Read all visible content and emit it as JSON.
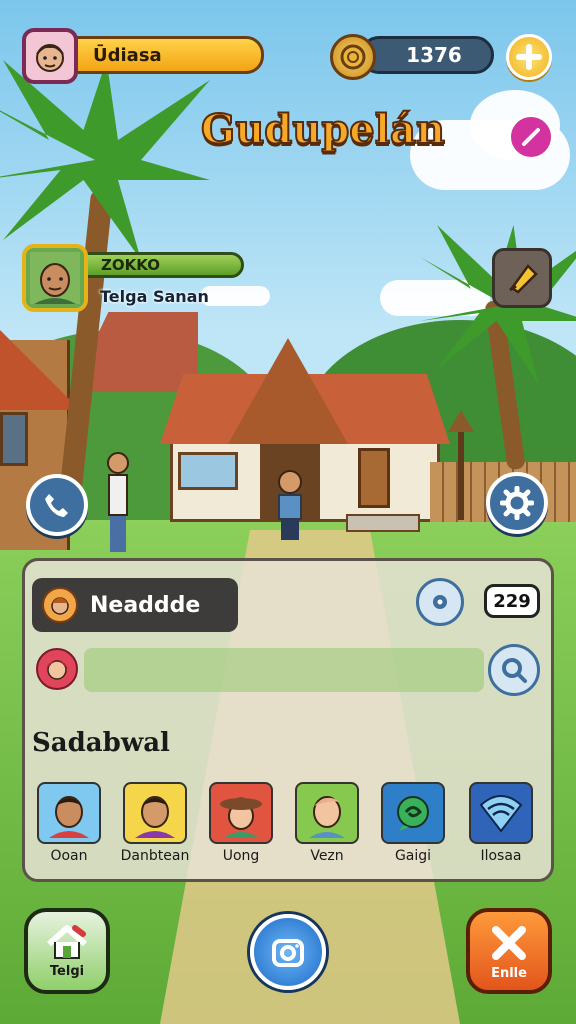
{
  "hud": {
    "player_name": "Ūdiasa",
    "coins": "1376"
  },
  "title": "Gudupelán",
  "npc": {
    "name": "ZOKKO",
    "location": "Telga Sanan"
  },
  "panel": {
    "chat_name": "Neaddde",
    "count": "229",
    "section_title": "Sadabwal",
    "characters": [
      {
        "name": "Ooan",
        "bg": "#7fc9f0"
      },
      {
        "name": "Danbtean",
        "bg": "#f5d54a"
      },
      {
        "name": "Uong",
        "bg": "#e15540"
      },
      {
        "name": "Vezn",
        "bg": "#86c94e"
      },
      {
        "name": "Gaigi",
        "bg": "#2e7fc8"
      },
      {
        "name": "Ilosaa",
        "bg": "#2f64b8"
      }
    ]
  },
  "bottom": {
    "home_label": "Telgi",
    "close_label": "Enlle"
  },
  "icons": [
    "player-avatar",
    "coin-icon",
    "plus-icon",
    "pencil-icon",
    "gem-icon",
    "phone-icon",
    "gear-icon",
    "camera-icon",
    "house-icon",
    "close-icon"
  ]
}
